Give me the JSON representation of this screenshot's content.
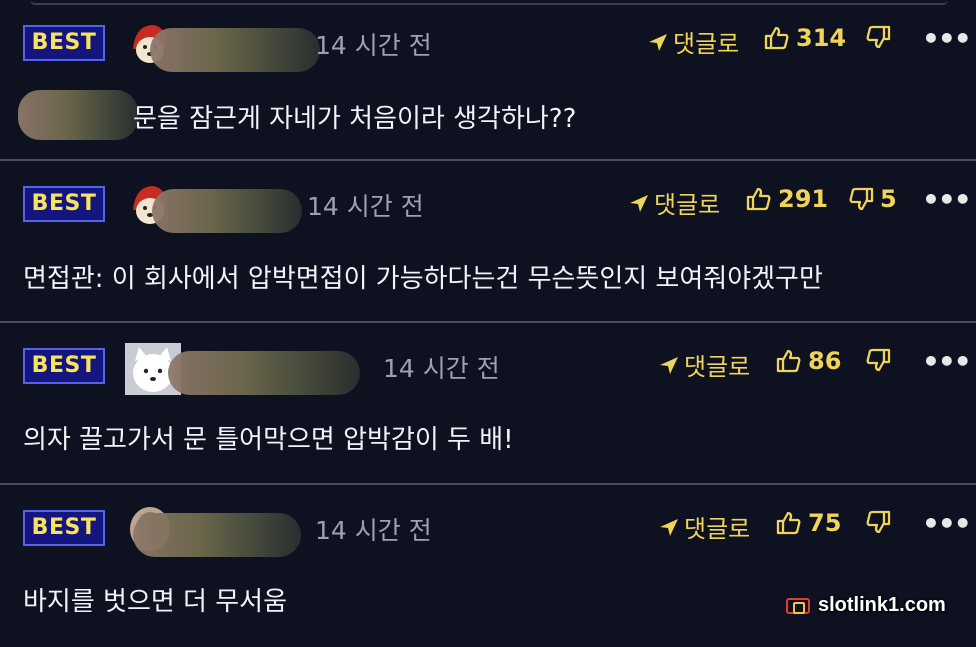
{
  "comments": [
    {
      "badge": "BEST",
      "time": "14 시간 전",
      "reply_label": "댓글로",
      "likes": "314",
      "dislikes": "",
      "text": "문을 잠근게 자네가 처음이라 생각하나??"
    },
    {
      "badge": "BEST",
      "time": "14 시간 전",
      "reply_label": "댓글로",
      "likes": "291",
      "dislikes": "5",
      "text": "면접관: 이 회사에서 압박면접이 가능하다는건 무슨뜻인지 보여줘야겠구만"
    },
    {
      "badge": "BEST",
      "time": "14 시간 전",
      "reply_label": "댓글로",
      "likes": "86",
      "dislikes": "",
      "text": "의자 끌고가서 문 틀어막으면 압박감이 두 배!"
    },
    {
      "badge": "BEST",
      "time": "14 시간 전",
      "reply_label": "댓글로",
      "likes": "75",
      "dislikes": "",
      "text": "바지를 벗으면 더 무서움"
    }
  ],
  "watermark": "slotlink1.com",
  "colors": {
    "background": "#0d1120",
    "accent": "#f0d35a",
    "badge_bg": "#14157e",
    "badge_border": "#5563e6"
  },
  "icons": {
    "reply": "paper-plane-icon",
    "like": "thumbs-up-icon",
    "dislike": "thumbs-down-icon",
    "more": "more-dots-icon"
  }
}
